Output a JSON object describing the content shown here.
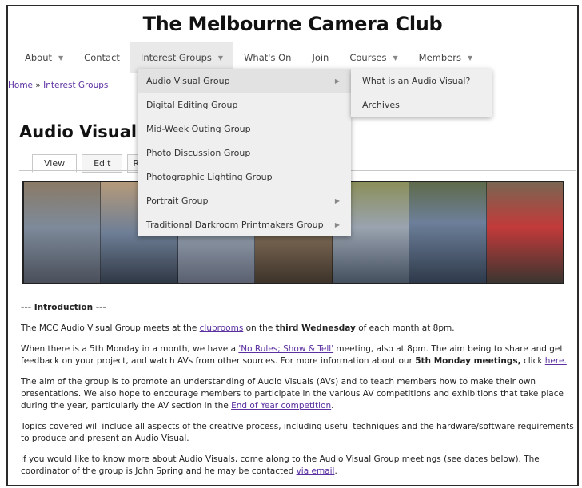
{
  "site_title": "The Melbourne Camera Club",
  "nav": [
    {
      "label": "About",
      "caret": "▼"
    },
    {
      "label": "Contact",
      "caret": ""
    },
    {
      "label": "Interest Groups",
      "caret": "▼"
    },
    {
      "label": "What's On",
      "caret": ""
    },
    {
      "label": "Join",
      "caret": ""
    },
    {
      "label": "Courses",
      "caret": "▼"
    },
    {
      "label": "Members",
      "caret": "▼"
    }
  ],
  "breadcrumb": {
    "home": "Home",
    "separator": " » ",
    "current": "Interest Groups"
  },
  "page_title": "Audio Visual G",
  "tabs": [
    "View",
    "Edit",
    "R"
  ],
  "dropdown": [
    {
      "label": "Audio Visual Group",
      "arrow": "▶"
    },
    {
      "label": "Digital Editing Group",
      "arrow": ""
    },
    {
      "label": "Mid-Week Outing Group",
      "arrow": ""
    },
    {
      "label": "Photo Discussion Group",
      "arrow": ""
    },
    {
      "label": "Photographic Lighting Group",
      "arrow": ""
    },
    {
      "label": "Portrait Group",
      "arrow": "▶"
    },
    {
      "label": "Traditional Darkroom Printmakers Group",
      "arrow": "▶"
    }
  ],
  "submenu": [
    "What is an Audio Visual?",
    "Archives"
  ],
  "content": {
    "intro_heading": "--- Introduction ---",
    "p1_a": "The MCC Audio Visual Group meets at the ",
    "p1_link": "clubrooms",
    "p1_b": " on the ",
    "p1_bold": "third Wednesday",
    "p1_c": " of each month at 8pm.",
    "p2_a": "When there is a 5th Monday in a month, we have a ",
    "p2_link": "'No Rules; Show & Tell'",
    "p2_b": " meeting, also at 8pm. The aim being to share and get feedback on your project, and watch AVs from other sources. For more information about our ",
    "p2_bold": "5th Monday meetings,",
    "p2_c": " click ",
    "p2_link2": "here.",
    "p3_a": "The aim of the group is to promote an understanding of Audio Visuals (AVs) and to teach members how to make their own presentations. We also hope to encourage members to participate in the various AV competitions and exhibitions that take place during the year, particularly the AV section in the ",
    "p3_link": "End of Year competition",
    "p3_b": ".",
    "p4": "Topics covered will include all aspects of the creative process, including useful techniques and the hardware/software requirements to produce and present an Audio Visual.",
    "p5_a": "If you would like to know more about Audio Visuals, come along to the Audio Visual Group meetings (see dates below). The coordinator of the group is John Spring and he may be contacted ",
    "p5_link": "via email",
    "p5_b": "."
  },
  "colors": {
    "link": "#5a2fa0",
    "menu_bg": "#efefef",
    "menu_hover": "#e2e2e2"
  }
}
